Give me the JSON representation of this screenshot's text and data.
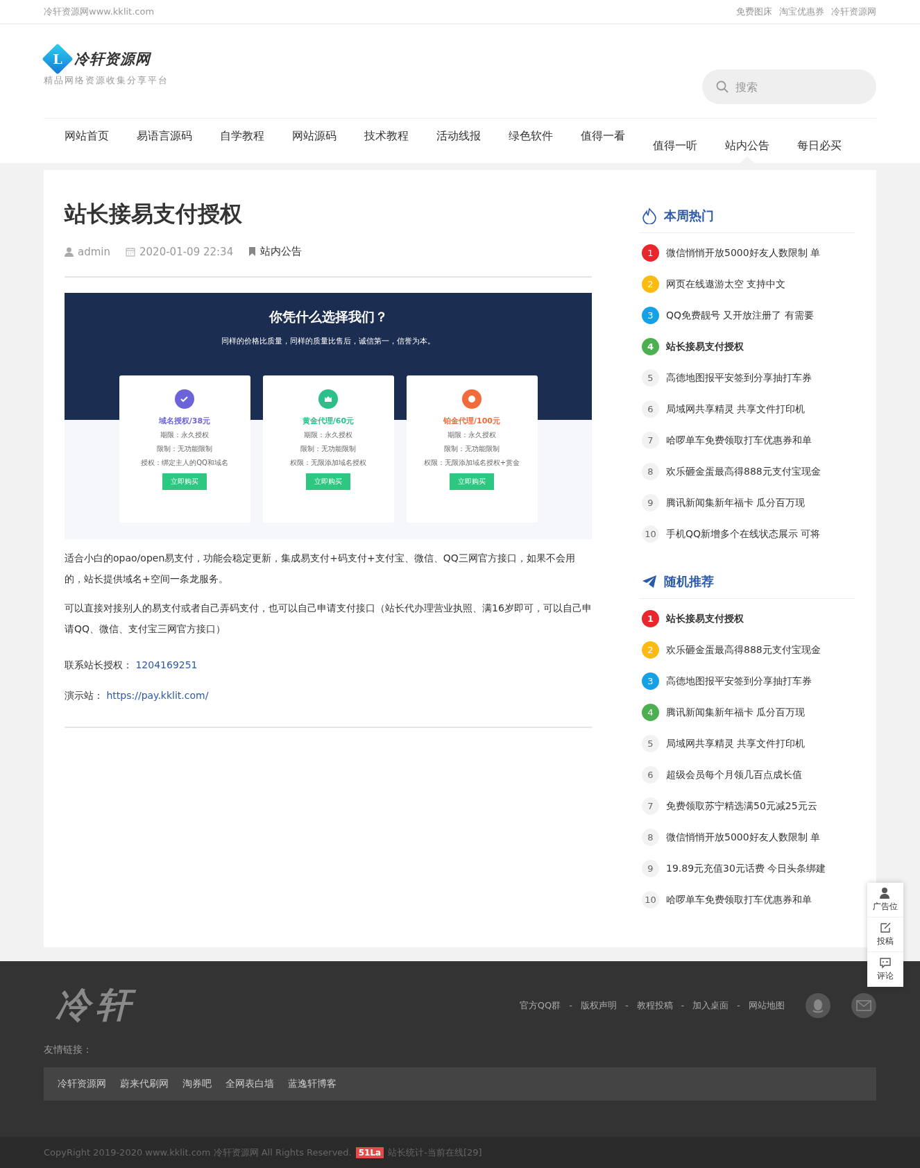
{
  "top_bar": {
    "site": "冷轩资源网www.kklit.com",
    "links": [
      "免费图床",
      "淘宝优惠券",
      "冷轩资源网"
    ]
  },
  "header": {
    "logo_title": "冷轩资源网",
    "logo_letter": "L",
    "tagline": "精品网络资源收集分享平台",
    "search": {
      "placeholder": "搜索"
    }
  },
  "nav": [
    {
      "label": "网站首页",
      "selected": false
    },
    {
      "label": "易语言源码",
      "selected": false
    },
    {
      "label": "自学教程",
      "selected": false
    },
    {
      "label": "网站源码",
      "selected": false
    },
    {
      "label": "技术教程",
      "selected": false
    },
    {
      "label": "活动线报",
      "selected": false
    },
    {
      "label": "绿色软件",
      "selected": false
    },
    {
      "label": "值得一看",
      "selected": false
    },
    {
      "label": "值得一听",
      "selected": false
    },
    {
      "label": "站内公告",
      "selected": true
    },
    {
      "label": "每日必买",
      "selected": false
    }
  ],
  "article": {
    "title": "站长接易支付授权",
    "author": "admin",
    "date": "2020-01-09 22:34",
    "category": "站内公告",
    "image": {
      "heading": "你凭什么选择我们？",
      "subheading": "同样的价格比质量，同样的质量比售后，诚信第一，信誉为本。",
      "plans": [
        {
          "title": "域名授权/38元",
          "color": "#6c63d9",
          "lines": [
            "期限：永久授权",
            "限制：无功能限制",
            "授权：绑定主人的QQ和域名"
          ],
          "button": "立即购买"
        },
        {
          "title": "黄金代理/60元",
          "color": "#2bbf8a",
          "lines": [
            "期限：永久授权",
            "限制：无功能限制",
            "权限：无限添加域名授权"
          ],
          "button": "立即购买"
        },
        {
          "title": "铂金代理/100元",
          "color": "#f26b3a",
          "lines": [
            "期限：永久授权",
            "限制：无功能限制",
            "权限：无限添加域名授权+赏金"
          ],
          "button": "立即购买"
        }
      ]
    },
    "paragraphs": [
      "适合小白的opao/open易支付，功能会稳定更新，集成易支付+码支付+支付宝、微信、QQ三网官方接口，如果不会用的，站长提供域名+空间一条龙服务。",
      "可以直接对接别人的易支付或者自己弄码支付，也可以自己申请支付接口（站长代办理营业执照、满16岁即可，可以自己申请QQ、微信、支付宝三网官方接口）"
    ],
    "contacts": [
      {
        "label": "联系站长授权：",
        "value": "1204169251"
      },
      {
        "label": "演示站：",
        "value": "https://pay.kklit.com/"
      }
    ]
  },
  "sidebar": [
    {
      "title": "本周热门",
      "kind": "flame",
      "items": [
        {
          "rank": "1",
          "text": "微信悄悄开放5000好友人数限制 单",
          "color": "#e8262b",
          "current": false
        },
        {
          "rank": "2",
          "text": "网页在线遨游太空 支持中文",
          "color": "#fbbb10",
          "current": false
        },
        {
          "rank": "3",
          "text": "QQ免费靓号 又开放注册了 有需要",
          "color": "#16a1e7",
          "current": false
        },
        {
          "rank": "4",
          "text": "站长接易支付授权",
          "color": "#4caf50",
          "current": true
        },
        {
          "rank": "5",
          "text": "高德地图报平安签到分享抽打车券",
          "color": "#f2f2f2",
          "current": false
        },
        {
          "rank": "6",
          "text": "局域网共享精灵 共享文件打印机",
          "color": "#f2f2f2",
          "current": false
        },
        {
          "rank": "7",
          "text": "哈啰单车免费领取打车优惠券和单",
          "color": "#f2f2f2",
          "current": false
        },
        {
          "rank": "8",
          "text": "欢乐砸金蛋最高得888元支付宝现金",
          "color": "#f2f2f2",
          "current": false
        },
        {
          "rank": "9",
          "text": "腾讯新闻集新年福卡 瓜分百万现",
          "color": "#f2f2f2",
          "current": false
        },
        {
          "rank": "10",
          "text": "手机QQ新增多个在线状态展示 可将",
          "color": "#f2f2f2",
          "current": false
        }
      ]
    },
    {
      "title": "随机推荐",
      "kind": "plane",
      "items": [
        {
          "rank": "1",
          "text": "站长接易支付授权",
          "color": "#e8262b",
          "current": true
        },
        {
          "rank": "2",
          "text": "欢乐砸金蛋最高得888元支付宝现金",
          "color": "#fbbb10",
          "current": false
        },
        {
          "rank": "3",
          "text": "高德地图报平安签到分享抽打车券",
          "color": "#16a1e7",
          "current": false
        },
        {
          "rank": "4",
          "text": "腾讯新闻集新年福卡 瓜分百万现",
          "color": "#4caf50",
          "current": false
        },
        {
          "rank": "5",
          "text": "局域网共享精灵 共享文件打印机",
          "color": "#f2f2f2",
          "current": false
        },
        {
          "rank": "6",
          "text": "超级会员每个月领几百点成长值",
          "color": "#f2f2f2",
          "current": false
        },
        {
          "rank": "7",
          "text": "免费领取苏宁精选满50元减25元云",
          "color": "#f2f2f2",
          "current": false
        },
        {
          "rank": "8",
          "text": "微信悄悄开放5000好友人数限制 单",
          "color": "#f2f2f2",
          "current": false
        },
        {
          "rank": "9",
          "text": "19.89元充值30元话费 今日头条绑建",
          "color": "#f2f2f2",
          "current": false
        },
        {
          "rank": "10",
          "text": "哈啰单车免费领取打车优惠券和单",
          "color": "#f2f2f2",
          "current": false
        }
      ]
    }
  ],
  "float_tools": [
    {
      "kind": "ad",
      "label": "广告位"
    },
    {
      "kind": "post",
      "label": "投稿"
    },
    {
      "kind": "comment",
      "label": "评论"
    }
  ],
  "footer": {
    "logo": "冷轩",
    "links": [
      "官方QQ群",
      "版权声明",
      "教程投稿",
      "加入桌面",
      "网站地图"
    ],
    "separator": "-",
    "friends_label": "友情链接：",
    "friends": [
      "冷轩资源网",
      "蔚来代刷网",
      "淘券吧",
      "全网表白墙",
      "蓝逸轩博客"
    ],
    "copyright": "CopyRight 2019-2020 www.kklit.com 冷轩资源网 All Rights Reserved.",
    "badge": "51La",
    "stats": "站长统计-当前在线[29]"
  }
}
